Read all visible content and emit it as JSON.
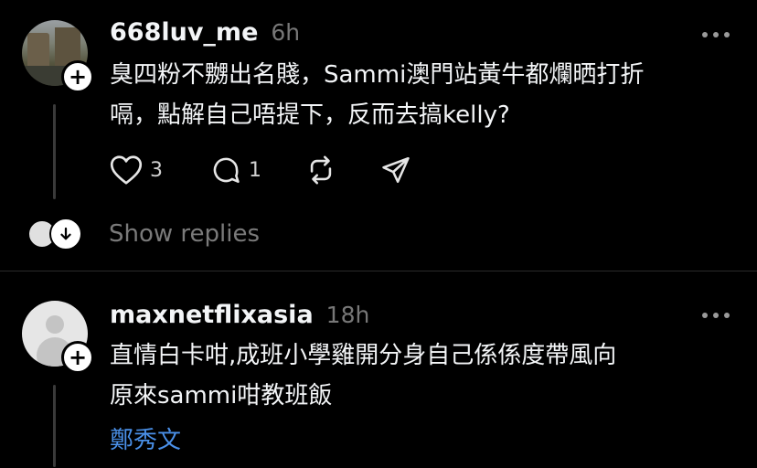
{
  "posts": [
    {
      "username": "668luv_me",
      "time": "6h",
      "body_line1": "臭四粉不嬲出名賤，Sammi澳門站黃牛都爛晒打折",
      "body_line2": "嗝，點解自己唔提下，反而去搞kelly?",
      "likes": "3",
      "replies": "1",
      "show_replies_label": "Show replies"
    },
    {
      "username": "maxnetflixasia",
      "time": "18h",
      "body_line1": "直情白卡咁,成班小學雞開分身自己係係度帶風向",
      "body_line2": "原來sammi咁教班飯",
      "mention": "鄭秀文"
    }
  ],
  "icons": {
    "like": "heart-icon",
    "reply": "comment-icon",
    "repost": "repost-icon",
    "share": "send-icon",
    "more": "more-icon",
    "follow": "plus-icon",
    "show_replies": "arrow-down-icon"
  },
  "colors": {
    "background": "#000000",
    "text": "#f3f5f7",
    "muted": "#777777",
    "link": "#4a90e8"
  }
}
